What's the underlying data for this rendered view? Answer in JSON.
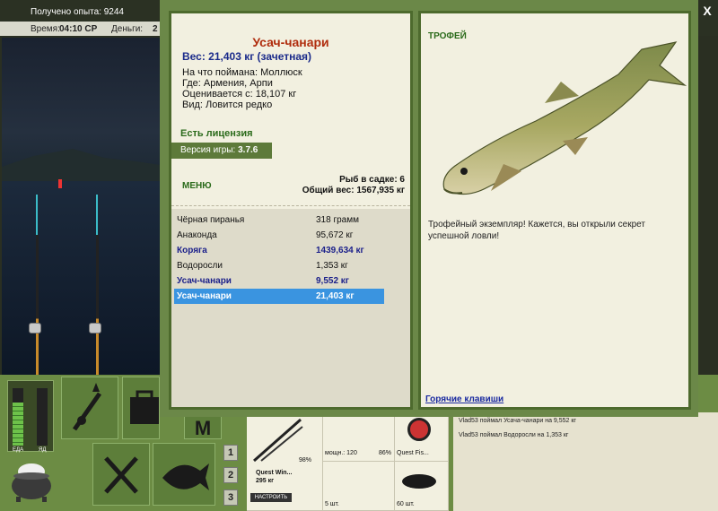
{
  "top": {
    "experience": "Получено опыта: 9244",
    "time_label": "Время:",
    "time_value": "04:10 СР",
    "money_label": "Деньги:",
    "money_value": "2"
  },
  "meters": {
    "food_label": "ЕДА",
    "poison_label": "ЯД",
    "food_level": 0.75,
    "poison_level": 0
  },
  "toolbar": {
    "buttons": [
      "1",
      "2",
      "3"
    ],
    "menu_letter": "M"
  },
  "inventory": {
    "rod_name": "Quest Win...",
    "rod_weight": "295 кг",
    "rod_percent": "98%",
    "setup_button": "НАСТРОИТЬ",
    "reel_info": "мощн.: 120",
    "reel_percent": "86%",
    "line_name": "Quest Fis...",
    "lure_count": "5 шт.",
    "bait_count": "60 шт."
  },
  "log": {
    "entries": [
      "Vlad53 поймал Усача-чанари на 9,552 кг",
      "Vlad53 поймал Водоросли на 1,353 кг"
    ]
  },
  "modal": {
    "close_symbol": "X",
    "fish_name": "Усач-чанари",
    "fish_weight": "Вес: 21,403 кг (зачетная)",
    "caught_with": "На что поймана: Моллюск",
    "location": "Где: Армения, Арпи",
    "valued_from": "Оценивается с: 18,107 кг",
    "rarity": "Вид: Ловится редко",
    "license": "Есть лицензия",
    "version_label": "Версия игры: ",
    "version_value": "3.7.6",
    "menu_label": "МЕНЮ",
    "cage_count": "Рыб в садке: 6",
    "total_weight": "Общий вес: 1567,935 кг",
    "catches": [
      {
        "name": "Чёрная пиранья",
        "weight": "318 грамм",
        "trophy": false,
        "selected": false
      },
      {
        "name": "Анаконда",
        "weight": "95,672 кг",
        "trophy": false,
        "selected": false
      },
      {
        "name": "Коряга",
        "weight": "1439,634 кг",
        "trophy": true,
        "selected": false
      },
      {
        "name": "Водоросли",
        "weight": "1,353 кг",
        "trophy": false,
        "selected": false
      },
      {
        "name": "Усач-чанари",
        "weight": "9,552 кг",
        "trophy": true,
        "selected": false
      },
      {
        "name": "Усач-чанари",
        "weight": "21,403 кг",
        "trophy": true,
        "selected": true
      }
    ],
    "trophy_title": "ТРОФЕЙ",
    "trophy_text": "Трофейный экземпляр! Кажется, вы открыли секрет успешной ловли!",
    "hotkeys": "Горячие клавиши"
  },
  "colors": {
    "fish_name": "#b02d0e",
    "weight_blue": "#1a2a8a",
    "selected_row": "#3a94e0",
    "panel_bg": "#f2f0e0",
    "modal_frame": "#6b8848"
  }
}
